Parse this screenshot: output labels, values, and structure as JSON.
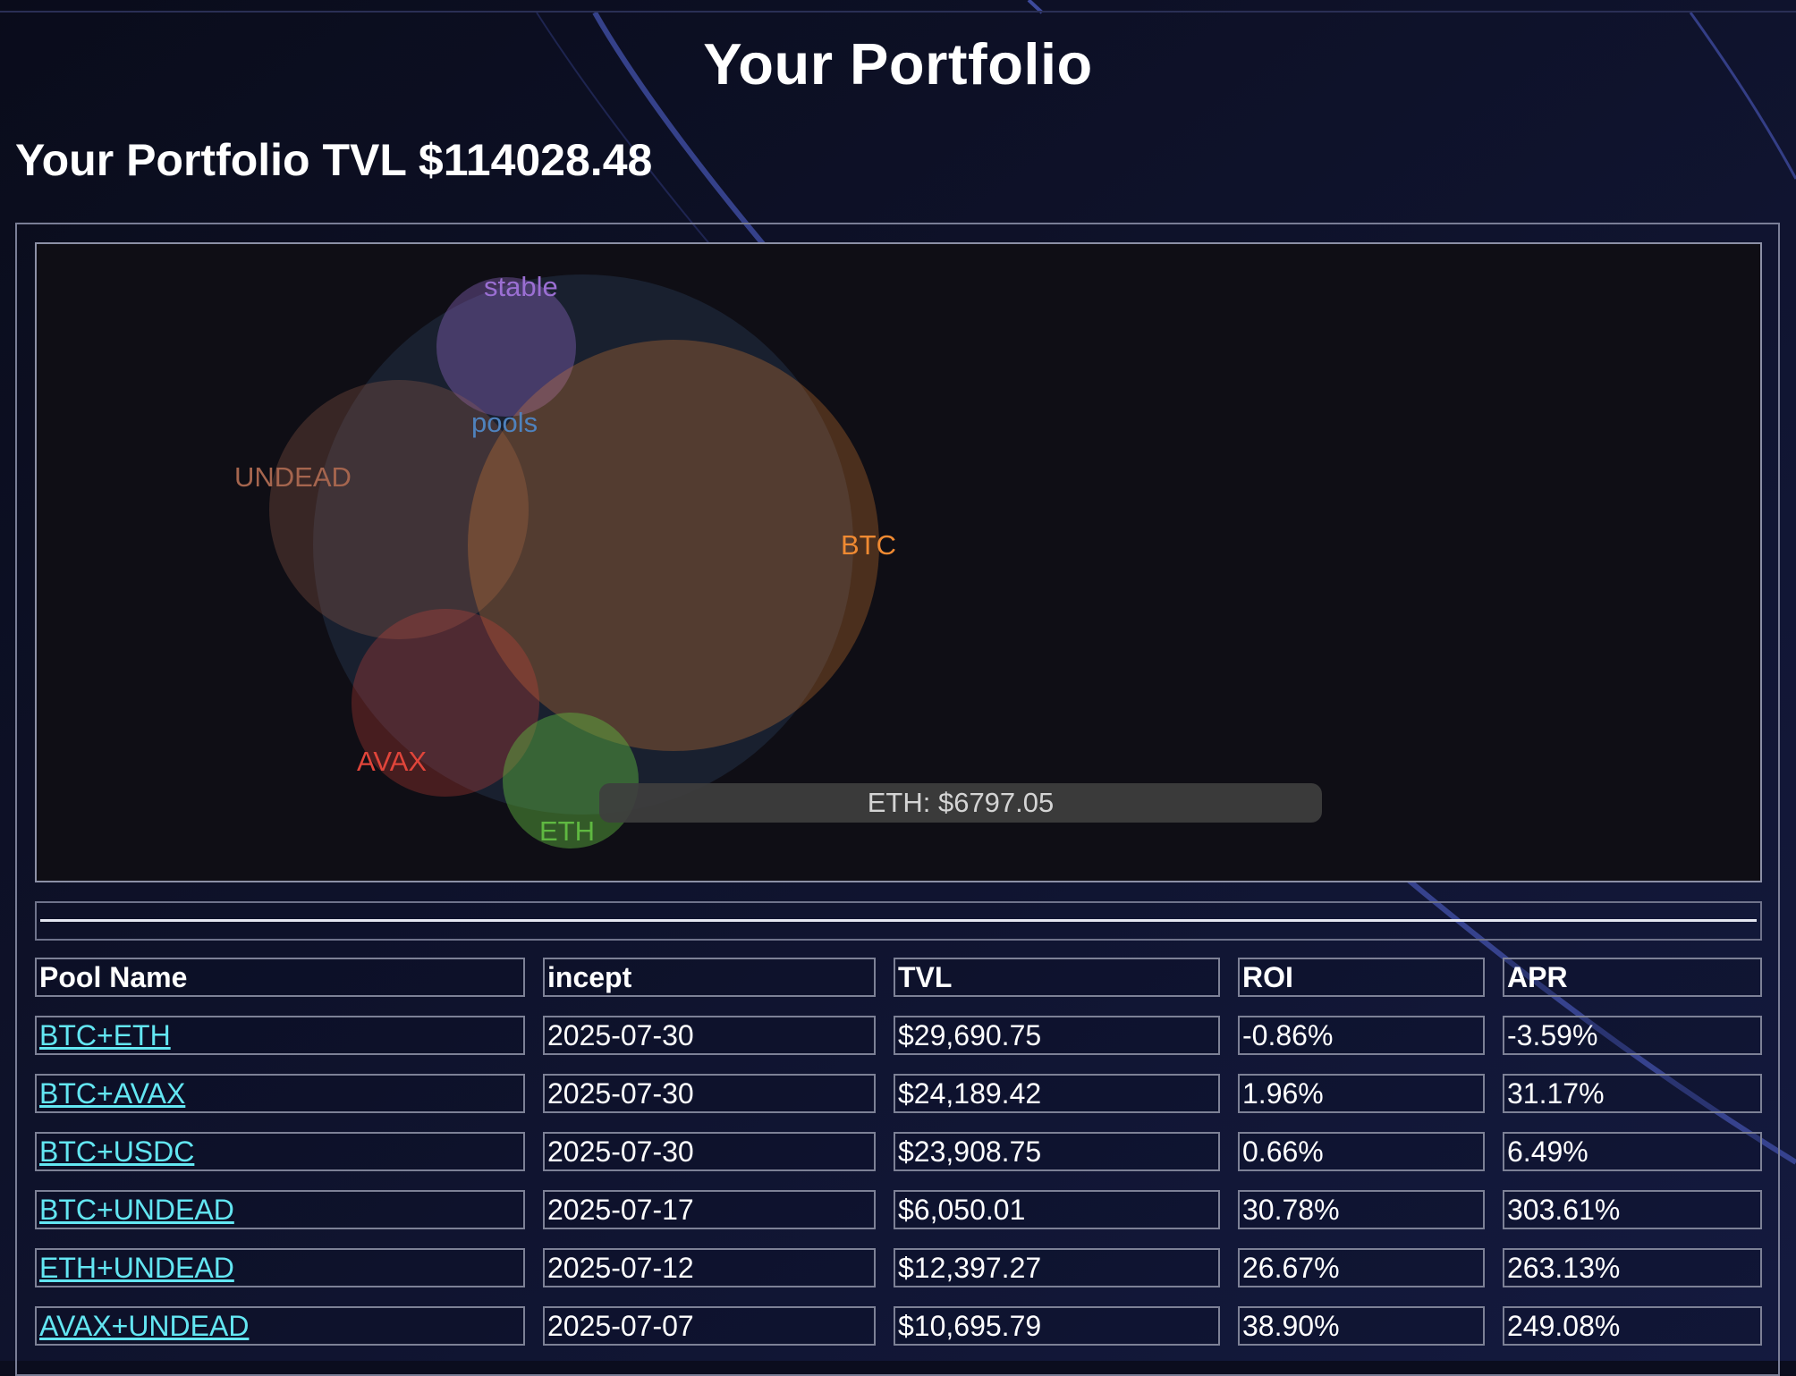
{
  "page": {
    "title": "Your Portfolio",
    "tvl_text": "Your Portfolio TVL $114028.48"
  },
  "tooltip": {
    "text": "ETH: $6797.05"
  },
  "bubble_chart": {
    "labels": [
      {
        "name": "stable-label",
        "text": "stable",
        "color": "#9b6fd3"
      },
      {
        "name": "pools-label",
        "text": "pools",
        "color": "#4f82bd"
      },
      {
        "name": "undead-label",
        "text": "UNDEAD",
        "color": "#a5654e"
      },
      {
        "name": "btc-label",
        "text": "BTC",
        "color": "#f08a32"
      },
      {
        "name": "avax-label",
        "text": "AVAX",
        "color": "#e0453a"
      },
      {
        "name": "eth-label",
        "text": "ETH",
        "color": "#5fb841"
      }
    ]
  },
  "table": {
    "columns": [
      "Pool Name",
      "incept",
      "TVL",
      "ROI",
      "APR"
    ],
    "rows": [
      {
        "pool": "BTC+ETH",
        "incept": "2025-07-30",
        "tvl": "$29,690.75",
        "roi": "-0.86%",
        "apr": "-3.59%"
      },
      {
        "pool": "BTC+AVAX",
        "incept": "2025-07-30",
        "tvl": "$24,189.42",
        "roi": "1.96%",
        "apr": "31.17%"
      },
      {
        "pool": "BTC+USDC",
        "incept": "2025-07-30",
        "tvl": "$23,908.75",
        "roi": "0.66%",
        "apr": "6.49%"
      },
      {
        "pool": "BTC+UNDEAD",
        "incept": "2025-07-17",
        "tvl": "$6,050.01",
        "roi": "30.78%",
        "apr": "303.61%"
      },
      {
        "pool": "ETH+UNDEAD",
        "incept": "2025-07-12",
        "tvl": "$12,397.27",
        "roi": "26.67%",
        "apr": "263.13%"
      },
      {
        "pool": "AVAX+UNDEAD",
        "incept": "2025-07-07",
        "tvl": "$10,695.79",
        "roi": "38.90%",
        "apr": "249.08%"
      }
    ]
  },
  "colors": {
    "background": "#0b0d1e",
    "link": "#63e6f2",
    "bubble_pools": "#4f82bd",
    "bubble_btc": "#f08a32",
    "bubble_undead": "#a5654e",
    "bubble_avax": "#e0453a",
    "bubble_eth": "#5fb841",
    "bubble_stable": "#9b6fd3"
  }
}
